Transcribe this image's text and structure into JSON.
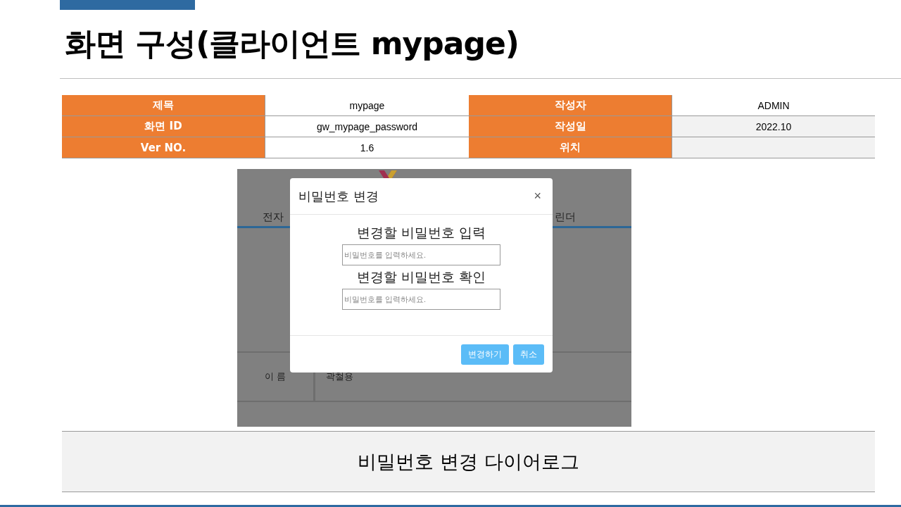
{
  "slide": {
    "title": "화면 구성(클라이언트 mypage)"
  },
  "info_table": {
    "rows": [
      [
        {
          "label": "제목",
          "value": "mypage"
        },
        {
          "label": "작성자",
          "value": "ADMIN"
        }
      ],
      [
        {
          "label": "화면 ID",
          "value": "gw_mypage_password"
        },
        {
          "label": "작성일",
          "value": "2022.10"
        }
      ],
      [
        {
          "label": "Ver NO.",
          "value": "1.6"
        },
        {
          "label": "위치"
        }
      ]
    ]
  },
  "screenshot": {
    "background_tabs": [
      "전자",
      "린더"
    ],
    "background_rows": [
      {
        "label": "이 름",
        "value": "곽철용"
      }
    ],
    "dialog": {
      "title": "비밀번호 변경",
      "close": "×",
      "fields": [
        {
          "label": "변경할 비밀번호 입력",
          "placeholder": "비밀번호를 입력하세요."
        },
        {
          "label": "변경할 비밀번호 확인",
          "placeholder": "비밀번호를 입력하세요."
        }
      ],
      "buttons": [
        "변경하기",
        "취소"
      ]
    }
  },
  "caption": "비밀번호 변경 다이어로그"
}
